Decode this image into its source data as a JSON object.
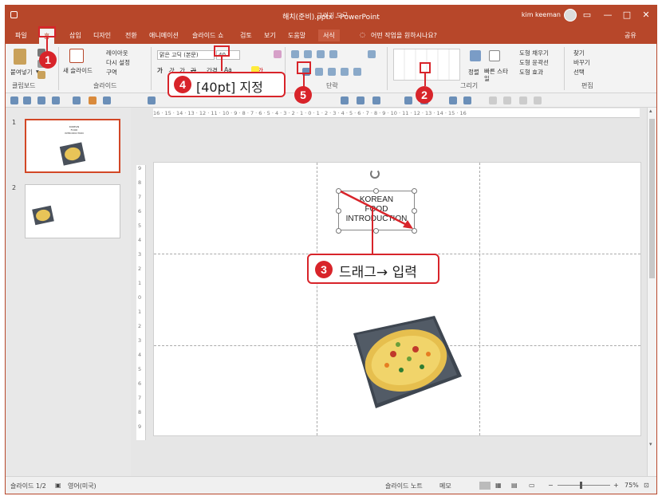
{
  "window": {
    "title": "해치(준비).pptx  -  PowerPoint",
    "context_title": "그리기 도구",
    "user": "kim keeman",
    "controls": {
      "restore": "▭",
      "minimize": "—",
      "maximize": "□",
      "close": "✕"
    }
  },
  "tabs": [
    {
      "label": "파일"
    },
    {
      "label": "홈"
    },
    {
      "label": "삽입"
    },
    {
      "label": "디자인"
    },
    {
      "label": "전환"
    },
    {
      "label": "애니메이션"
    },
    {
      "label": "슬라이드 쇼"
    },
    {
      "label": "검토"
    },
    {
      "label": "보기"
    },
    {
      "label": "도움말"
    },
    {
      "label": "서식"
    }
  ],
  "tell_me": "어떤 작업을 원하시나요?",
  "share": "공유",
  "ribbon": {
    "clipboard": {
      "label": "클립보드",
      "paste": "붙여넣기",
      "paste_arrow": "▾"
    },
    "slides": {
      "label": "슬라이드",
      "new_slide": "새 슬라이드",
      "layout": "레이아웃",
      "reset": "다시 설정",
      "section": "구역"
    },
    "font": {
      "name": "맑은 고딕 (본문)",
      "size": "40",
      "bold": "가",
      "italic": "가",
      "underline": "가",
      "strike": "가",
      "case": "Aa",
      "spacing": "간격",
      "color": "가"
    },
    "paragraph": {
      "label": "단락"
    },
    "drawing": {
      "label": "그리기",
      "arrange": "정렬",
      "quick_styles": "빠른 스타일",
      "shape_fill": "도형 채우기",
      "shape_outline": "도형 윤곽선",
      "shape_effects": "도형 효과"
    },
    "editing": {
      "label": "편집",
      "find": "찾기",
      "replace": "바꾸기",
      "select": "선택"
    }
  },
  "slide_panel": [
    {
      "number": "1"
    },
    {
      "number": "2"
    }
  ],
  "slide": {
    "textbox_lines": [
      "KOREAN",
      "FOOD",
      "INTRODUCTION"
    ],
    "thumb_caption_lines": [
      "KOREAN",
      "FOOD",
      "INTRODUCTION"
    ]
  },
  "ruler": {
    "h": "16 · 15 · 14 · 13 · 12 · 11 · 10 · 9 · 8 · 7 · 6 · 5 · 4 · 3 · 2 · 1 · 0 · 1 · 2 · 3 · 4 · 5 · 6 · 7 · 8 · 9 · 10 · 11 · 12 · 13 · 14 · 15 · 16",
    "v": [
      "9",
      "8",
      "7",
      "6",
      "5",
      "4",
      "3",
      "2",
      "1",
      "0",
      "1",
      "2",
      "3",
      "4",
      "5",
      "6",
      "7",
      "8",
      "9"
    ]
  },
  "statusbar": {
    "slide_count": "슬라이드 1/2",
    "language": "영어(미국)",
    "notes": "슬라이드 노트",
    "comments": "메모",
    "zoom": "75%",
    "zoom_minus": "−",
    "zoom_plus": "+"
  },
  "annotations": {
    "step1": "1",
    "step2": "2",
    "step3_num": "3",
    "step3_text": "드래그→ 입력",
    "step4_num": "4",
    "step4_text": "[40pt] 지정",
    "step5": "5"
  },
  "colors": {
    "accent": "#b7472a",
    "annotation": "#d8242a",
    "selected_thumb": "#d24726"
  }
}
